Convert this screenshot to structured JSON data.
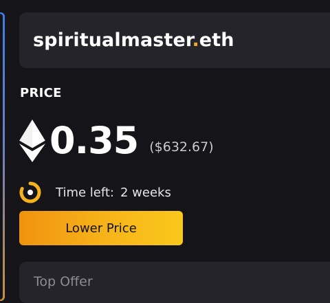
{
  "domain": {
    "name": "spiritualmaster",
    "dot": ".",
    "tld": "eth"
  },
  "price": {
    "label": "PRICE",
    "value": "0.35",
    "usd": "($632.67)",
    "currency_icon": "ethereum-icon"
  },
  "time": {
    "icon": "clock-icon",
    "label": "Time left:",
    "value": "2 weeks"
  },
  "actions": {
    "lower_price_label": "Lower Price"
  },
  "offers": {
    "label": "Top Offer"
  },
  "colors": {
    "background": "#151418",
    "card": "#25242b",
    "accent": "#f5a623",
    "button_start": "#f0930f",
    "button_end": "#fac81c"
  }
}
